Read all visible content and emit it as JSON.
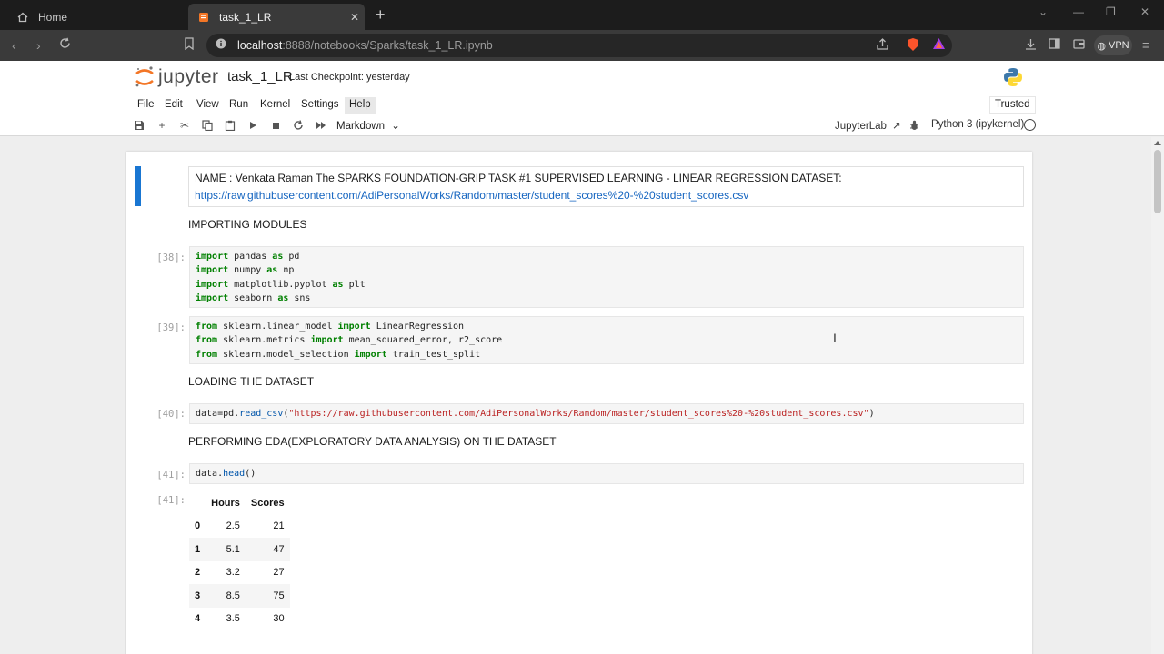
{
  "browser": {
    "tabs": [
      {
        "label": "Home",
        "active": false
      },
      {
        "label": "task_1_LR",
        "active": true
      }
    ],
    "url_host": "localhost",
    "url_path": ":8888/notebooks/Sparks/task_1_LR.ipynb",
    "vpn_label": "VPN"
  },
  "jupyter": {
    "logo_text": "jupyter",
    "notebook_title": "task_1_LR",
    "checkpoint": "Last Checkpoint: yesterday",
    "menu": [
      "File",
      "Edit",
      "View",
      "Run",
      "Kernel",
      "Settings",
      "Help"
    ],
    "trusted": "Trusted",
    "cell_type": "Markdown",
    "jupyterlab_link": "JupyterLab",
    "kernel": "Python 3 (ipykernel)"
  },
  "cells": {
    "intro_line1": "NAME : Venkata Raman The SPARKS FOUNDATION-GRIP TASK #1 SUPERVISED LEARNING - LINEAR REGRESSION DATASET:",
    "intro_link": "https://raw.githubusercontent.com/AdiPersonalWorks/Random/master/student_scores%20-%20student_scores.csv",
    "heading_importing": "IMPORTING MODULES",
    "heading_loading": "LOADING THE DATASET",
    "heading_eda": "PERFORMING EDA(EXPLORATORY DATA ANALYSIS) ON THE DATASET",
    "prompt_38": "[38]:",
    "prompt_39": "[39]:",
    "prompt_40": "[40]:",
    "prompt_41": "[41]:",
    "prompt_41_out": "[41]:",
    "code_38": [
      {
        "kw1": "import",
        "mod": " pandas ",
        "kw2": "as",
        "alias": " pd"
      },
      {
        "kw1": "import",
        "mod": " numpy ",
        "kw2": "as",
        "alias": " np"
      },
      {
        "kw1": "import",
        "mod": " matplotlib.pyplot ",
        "kw2": "as",
        "alias": " plt"
      },
      {
        "kw1": "import",
        "mod": " seaborn ",
        "kw2": "as",
        "alias": " sns"
      }
    ],
    "code_39": [
      {
        "kw1": "from",
        "mod": " sklearn.linear_model ",
        "kw2": "import",
        "names": " LinearRegression"
      },
      {
        "kw1": "from",
        "mod": " sklearn.metrics ",
        "kw2": "import",
        "names": " mean_squared_error, r2_score"
      },
      {
        "kw1": "from",
        "mod": " sklearn.model_selection ",
        "kw2": "import",
        "names": " train_test_split"
      }
    ],
    "code_40_var": "data=pd.",
    "code_40_fn": "read_csv",
    "code_40_str": "\"https://raw.githubusercontent.com/AdiPersonalWorks/Random/master/student_scores%20-%20student_scores.csv\"",
    "code_41_var": "data.",
    "code_41_fn": "head",
    "code_41_tail": "()"
  },
  "dataframe": {
    "columns": [
      "Hours",
      "Scores"
    ],
    "rows": [
      {
        "index": "0",
        "Hours": "2.5",
        "Scores": "21"
      },
      {
        "index": "1",
        "Hours": "5.1",
        "Scores": "47"
      },
      {
        "index": "2",
        "Hours": "3.2",
        "Scores": "27"
      },
      {
        "index": "3",
        "Hours": "8.5",
        "Scores": "75"
      },
      {
        "index": "4",
        "Hours": "3.5",
        "Scores": "30"
      }
    ]
  },
  "colors": {
    "selection_bar": "#1976d2",
    "keyword": "#008000",
    "string": "#ba2121",
    "link": "#1565c0"
  }
}
